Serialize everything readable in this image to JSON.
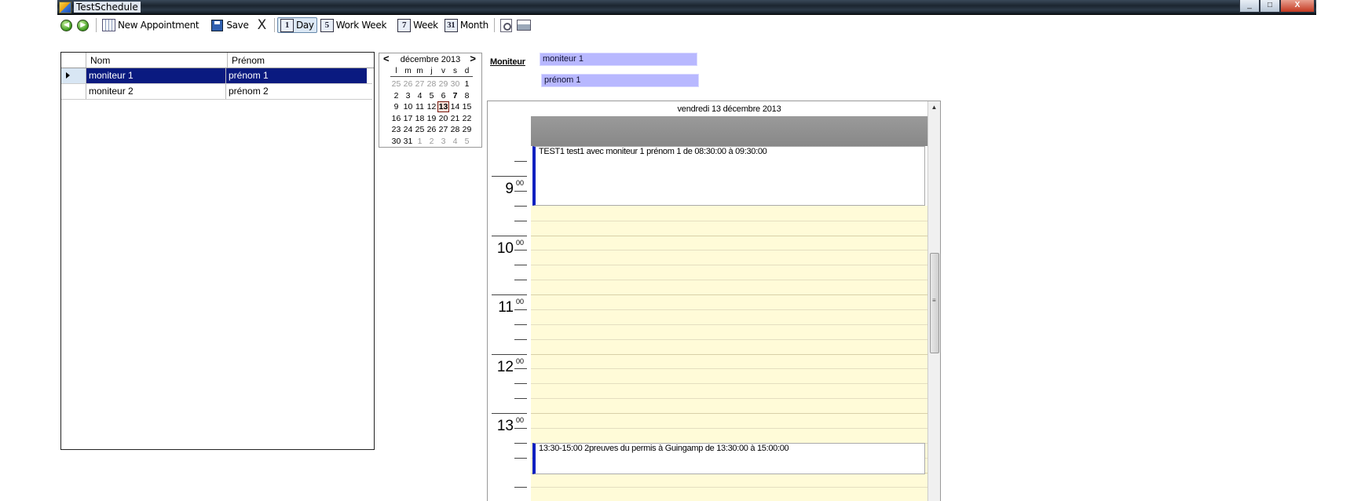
{
  "window": {
    "title": "TestSchedule",
    "buttons": [
      "_",
      "□",
      "X"
    ]
  },
  "toolbar": {
    "new_appointment": "New Appointment",
    "save": "Save",
    "delete": "X",
    "day": "Day",
    "work_week": "Work Week",
    "week": "Week",
    "month": "Month",
    "day_icon": "1",
    "work_week_icon": "5",
    "week_icon": "7",
    "month_icon": "31",
    "prev_icon": "◀",
    "next_icon": "▶"
  },
  "grid": {
    "columns": [
      "Nom",
      "Prénom"
    ],
    "rows": [
      {
        "nom": "moniteur 1",
        "prenom": "prénom 1",
        "selected": true
      },
      {
        "nom": "moniteur 2",
        "prenom": "prénom 2",
        "selected": false
      }
    ]
  },
  "minical": {
    "month_label": "décembre 2013",
    "prev": "<",
    "next": ">",
    "day_headers": [
      "l",
      "m",
      "m",
      "j",
      "v",
      "s",
      "d"
    ],
    "weeks": [
      [
        {
          "d": "25",
          "o": true
        },
        {
          "d": "26",
          "o": true
        },
        {
          "d": "27",
          "o": true
        },
        {
          "d": "28",
          "o": true
        },
        {
          "d": "29",
          "o": true
        },
        {
          "d": "30",
          "o": true
        },
        {
          "d": "1"
        }
      ],
      [
        {
          "d": "2"
        },
        {
          "d": "3"
        },
        {
          "d": "4"
        },
        {
          "d": "5"
        },
        {
          "d": "6"
        },
        {
          "d": "7",
          "b": true
        },
        {
          "d": "8"
        }
      ],
      [
        {
          "d": "9"
        },
        {
          "d": "10"
        },
        {
          "d": "11"
        },
        {
          "d": "12"
        },
        {
          "d": "13",
          "t": true
        },
        {
          "d": "14"
        },
        {
          "d": "15"
        }
      ],
      [
        {
          "d": "16"
        },
        {
          "d": "17"
        },
        {
          "d": "18"
        },
        {
          "d": "19"
        },
        {
          "d": "20"
        },
        {
          "d": "21"
        },
        {
          "d": "22"
        }
      ],
      [
        {
          "d": "23"
        },
        {
          "d": "24"
        },
        {
          "d": "25"
        },
        {
          "d": "26"
        },
        {
          "d": "27"
        },
        {
          "d": "28"
        },
        {
          "d": "29"
        }
      ],
      [
        {
          "d": "30"
        },
        {
          "d": "31"
        },
        {
          "d": "1",
          "o": true
        },
        {
          "d": "2",
          "o": true
        },
        {
          "d": "3",
          "o": true
        },
        {
          "d": "4",
          "o": true
        },
        {
          "d": "5",
          "o": true
        }
      ]
    ]
  },
  "moniteur": {
    "label": "Moniteur",
    "name": "moniteur 1",
    "prenom": "prénom 1"
  },
  "dayview": {
    "header": "vendredi 13 décembre 2013",
    "hours": [
      "9",
      "10",
      "11",
      "12",
      "13"
    ],
    "minutes": "00",
    "appointments": [
      "TEST1 test1 avec moniteur 1 prénom 1 de 08:30:00 à 09:30:00",
      "13:30-15:00 2preuves du permis à Guingamp  de 13:30:00 à 15:00:00"
    ]
  },
  "colors": {
    "selection": "#0a1a80",
    "moniteur_box": "#b8b8ff",
    "workhours": "#fffbd8",
    "appointment_bar": "#1020c0"
  }
}
